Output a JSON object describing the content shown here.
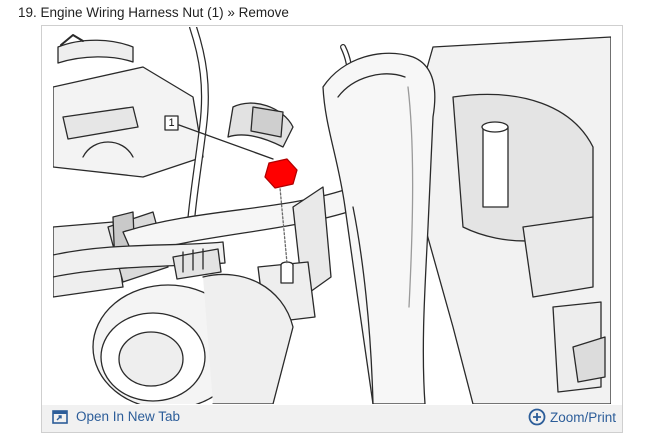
{
  "step": {
    "title": "19. Engine Wiring Harness Nut (1) » Remove"
  },
  "figure": {
    "callout_number": "1",
    "highlight_color": "#ff0000"
  },
  "toolbar": {
    "open_in_new_tab_label": "Open In New Tab",
    "zoom_print_label": "Zoom/Print"
  },
  "colors": {
    "link": "#2c5d99",
    "toolbar_bg": "#f1f1f1",
    "frame_border": "#cfcfcf"
  },
  "icons": [
    "open-in-new-tab-icon",
    "zoom-plus-icon"
  ]
}
